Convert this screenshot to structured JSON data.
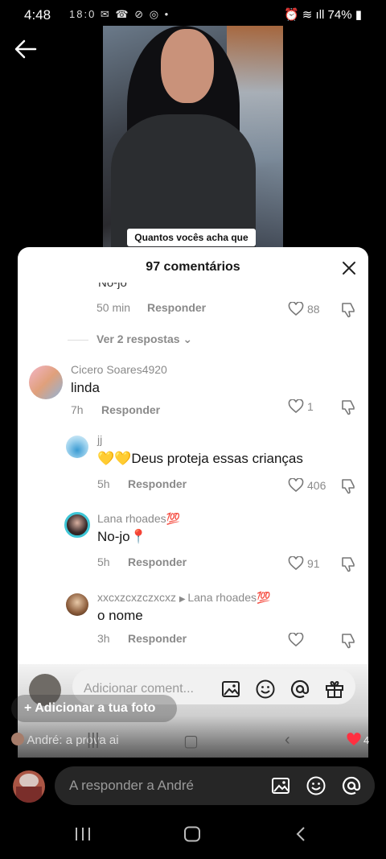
{
  "status_bar": {
    "time": "4:48",
    "left_icons": "18:0 ✉ ☎ ⊘ ◎ •",
    "right_text": "74%"
  },
  "video": {
    "caption": "Quantos vocês acha que"
  },
  "comments": {
    "title": "97 comentários",
    "cut_text": "No-jo",
    "first": {
      "time": "50 min",
      "reply_label": "Responder",
      "likes": "88"
    },
    "view_replies": "Ver 2 respostas",
    "items": [
      {
        "username": "Cicero Soares4920",
        "text": "linda",
        "time": "7h",
        "reply_label": "Responder",
        "likes": "1"
      },
      {
        "username": "jj",
        "text": "💛💛Deus proteja essas crianças",
        "time": "5h",
        "reply_label": "Responder",
        "likes": "406"
      },
      {
        "username": "Lana rhoades💯",
        "text": "No-jo📍",
        "time": "5h",
        "reply_label": "Responder",
        "likes": "91"
      },
      {
        "username": "xxcxzcxzczxcxz",
        "reply_to": "Lana rhoades💯",
        "text": "o nome",
        "time": "3h",
        "reply_label": "Responder",
        "likes": ""
      }
    ],
    "input_placeholder": "Adicionar coment..."
  },
  "overlay": {
    "add_photo": "+ Adicionar a tua foto",
    "reply_context_user": "André",
    "reply_context_text": ": a prova ai",
    "heart_count": "4"
  },
  "bottom": {
    "reply_placeholder": "A responder a André"
  },
  "colors": {
    "heart": "#ff3040",
    "sheet_bg": "#ffffff",
    "muted": "#8a8a8a"
  }
}
